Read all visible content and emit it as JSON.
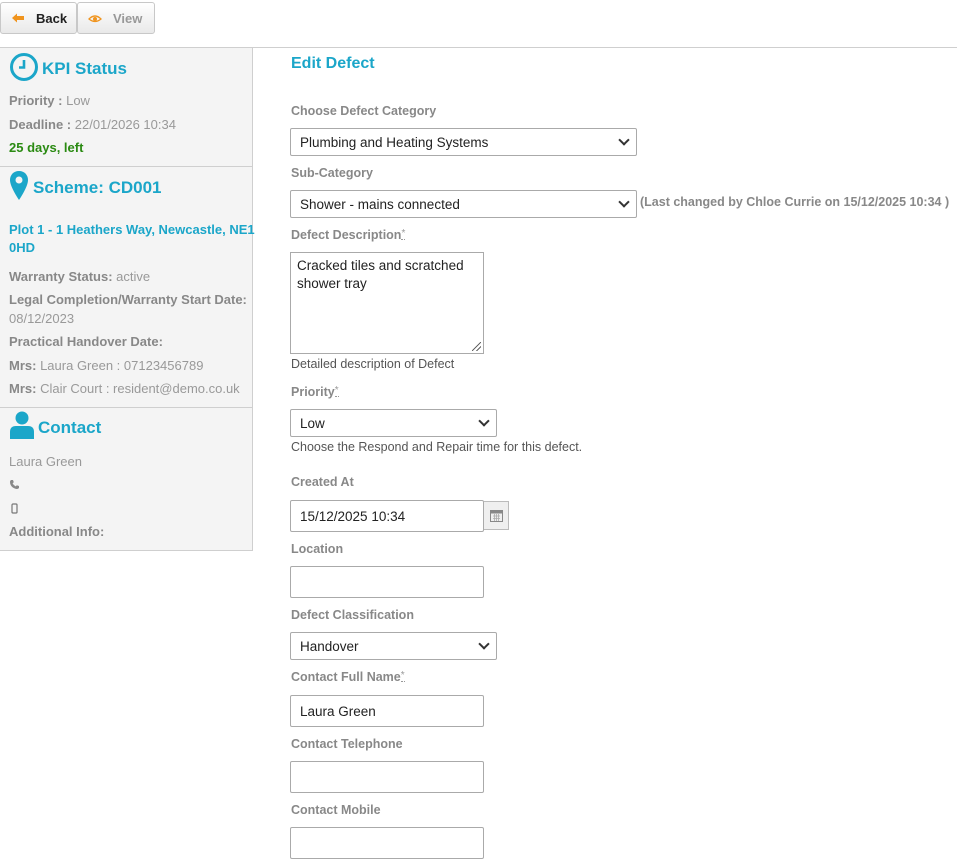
{
  "toolbar": {
    "back_label": "Back",
    "view_label": "View"
  },
  "kpi": {
    "title": "KPI Status",
    "priority_label": "Priority :",
    "priority_value": "Low",
    "deadline_label": "Deadline :",
    "deadline_value": "22/01/2026 10:34",
    "days_left": "25 days, left"
  },
  "scheme": {
    "title": "Scheme: CD001",
    "address_line1": "Plot 1 - 1 Heathers Way, Newcastle, NE1",
    "address_line2": "0HD",
    "warranty_label": "Warranty Status:",
    "warranty_value": "active",
    "legal_label": "Legal Completion/Warranty Start Date:",
    "legal_value": "08/12/2023",
    "handover_label": "Practical Handover Date:",
    "resident1_title": "Mrs:",
    "resident1_value": "Laura Green : 07123456789",
    "resident2_title": "Mrs:",
    "resident2_value": "Clair Court : resident@demo.co.uk"
  },
  "contact": {
    "title": "Contact",
    "name": "Laura Green",
    "additional_label": "Additional Info:"
  },
  "form": {
    "heading": "Edit Defect",
    "category_label": "Choose Defect Category",
    "category_value": "Plumbing and Heating Systems",
    "subcategory_label": "Sub-Category",
    "subcategory_value": "Shower - mains connected",
    "last_changed_note": "(Last changed by Chloe Currie on 15/12/2025 10:34 )",
    "description_label": "Defect Description",
    "required_mark": "*",
    "description_value": "Cracked tiles and scratched shower tray",
    "description_help": "Detailed description of Defect",
    "priority_label": "Priority",
    "priority_value": "Low",
    "priority_help": "Choose the Respond and Repair time for this defect.",
    "created_label": "Created At",
    "created_value": "15/12/2025 10:34",
    "location_label": "Location",
    "location_value": "",
    "classification_label": "Defect Classification",
    "classification_value": "Handover",
    "contact_name_label": "Contact Full Name",
    "contact_name_value": "Laura Green",
    "contact_tel_label": "Contact Telephone",
    "contact_tel_value": "",
    "contact_mobile_label": "Contact Mobile",
    "contact_mobile_value": ""
  },
  "colors": {
    "accent": "#1ba6c9",
    "good": "#2a8a12",
    "back_arrow": "#f0941e"
  }
}
